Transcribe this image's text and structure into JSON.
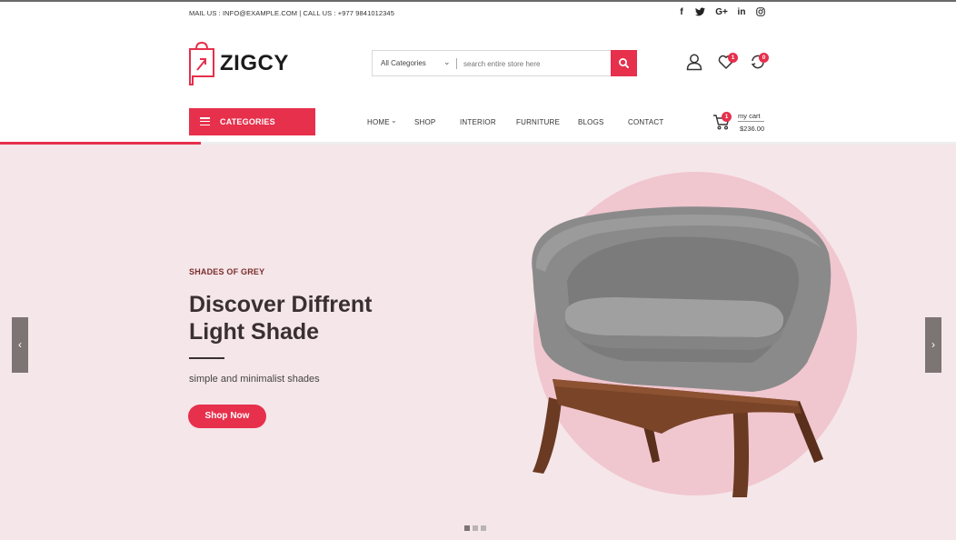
{
  "topbar": {
    "contact": "MAIL US : INFO@EXAMPLE.COM | CALL US : +977 9841012345",
    "social": [
      "f",
      "t",
      "G+",
      "in",
      "ig"
    ]
  },
  "header": {
    "logo": "ZIGCY",
    "search": {
      "category": "All Categories",
      "placeholder": "search entire store here"
    },
    "wishlist_count": "1",
    "compare_count": "0"
  },
  "nav": {
    "categories_label": "CATEGORIES",
    "items": [
      "HOME",
      "SHOP",
      "INTERIOR",
      "FURNITURE",
      "BLOGS",
      "CONTACT"
    ],
    "cart": {
      "count": "1",
      "label": "my cart",
      "total": "$236.00"
    }
  },
  "hero": {
    "subtitle": "SHADES OF GREY",
    "headline": "Discover Diffrent Light Shade",
    "description": "simple and minimalist shades",
    "button": "Shop Now",
    "slide_count": 3,
    "active_slide": 1,
    "progress": 0.21
  },
  "colors": {
    "accent": "#e6304c",
    "hero_bg": "#f5e6e9",
    "circle": "#f0c6cf",
    "chair_fabric": "#8a8a8a",
    "chair_wood": "#6b3a22"
  }
}
